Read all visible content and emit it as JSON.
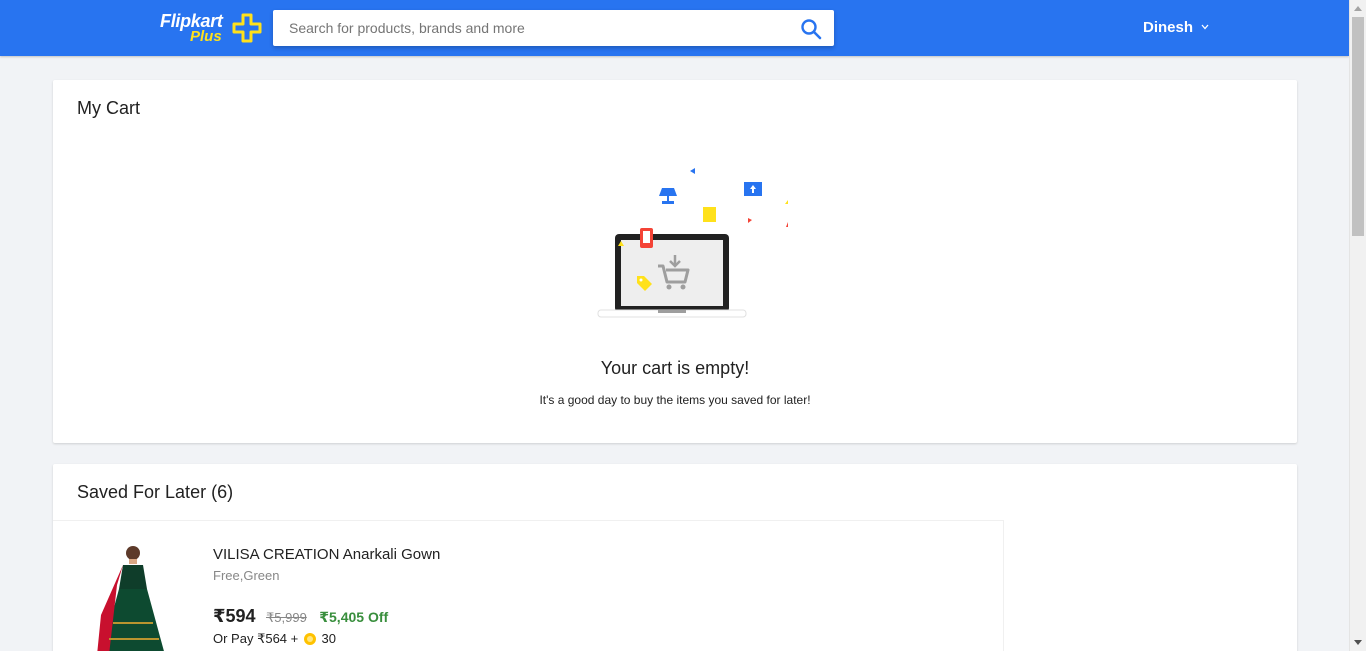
{
  "header": {
    "logo_main": "Flipkart",
    "logo_sub": "Plus",
    "search_placeholder": "Search for products, brands and more",
    "user_name": "Dinesh"
  },
  "cart": {
    "title": "My Cart",
    "empty_title": "Your cart is empty!",
    "empty_subtitle": "It's a good day to buy the items you saved for later!"
  },
  "saved": {
    "title": "Saved For Later (6)",
    "items": [
      {
        "name": "VILISA CREATION Anarkali Gown",
        "variant": "Free,Green",
        "price": "₹594",
        "mrp": "₹5,999",
        "discount": "₹5,405 Off",
        "or_pay_prefix": "Or Pay ₹564 +",
        "coins": "30"
      }
    ]
  },
  "colors": {
    "brand_blue": "#2874f0",
    "plus_yellow": "#ffe11b",
    "discount_green": "#388e3c"
  }
}
